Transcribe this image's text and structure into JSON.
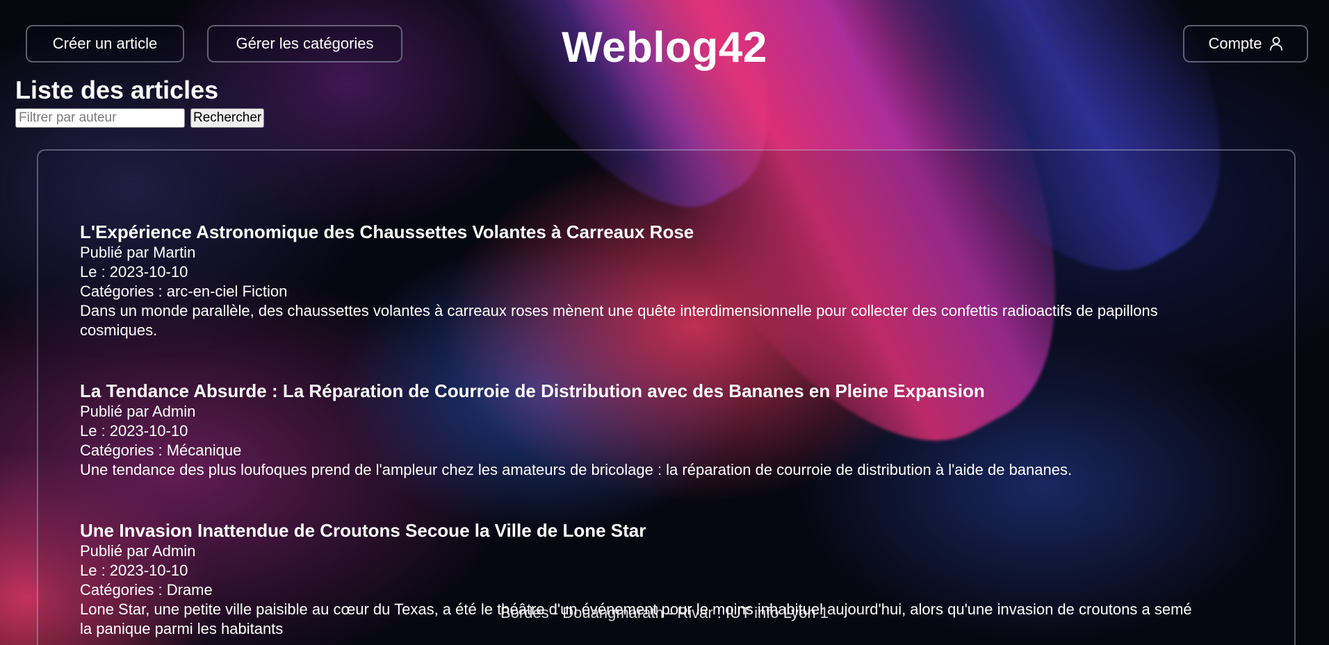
{
  "header": {
    "create_label": "Créer un article",
    "categories_label": "Gérer les catégories",
    "brand": "Weblog42",
    "account_label": "Compte",
    "account_icon": "user-icon"
  },
  "main": {
    "title": "Liste des articles",
    "filter": {
      "placeholder": "Filtrer par auteur",
      "value": "",
      "search_label": "Rechercher"
    }
  },
  "articles": [
    {
      "title": "L'Expérience Astronomique des Chaussettes Volantes à Carreaux Rose",
      "author": "Publié par Martin",
      "date": "Le : 2023-10-10",
      "categories": "Catégories : arc-en-ciel Fiction",
      "summary": "Dans un monde parallèle, des chaussettes volantes à carreaux roses mènent une quête interdimensionnelle pour collecter des confettis radioactifs de papillons cosmiques."
    },
    {
      "title": "La Tendance Absurde : La Réparation de Courroie de Distribution avec des Bananes en Pleine Expansion",
      "author": "Publié par Admin",
      "date": "Le : 2023-10-10",
      "categories": "Catégories : Mécanique",
      "summary": "Une tendance des plus loufoques prend de l'ampleur chez les amateurs de bricolage : la réparation de courroie de distribution à l'aide de bananes."
    },
    {
      "title": "Une Invasion Inattendue de Croutons Secoue la Ville de Lone Star",
      "author": "Publié par Admin",
      "date": "Le : 2023-10-10",
      "categories": "Catégories : Drame",
      "summary": "Lone Star, une petite ville paisible au cœur du Texas, a été le théâtre d'un événement pour le moins inhabituel aujourd'hui, alors qu'une invasion de croutons a semé la panique parmi les habitants"
    }
  ],
  "footer": {
    "text": "Bordes - Douangmarath - Rivar : IUT info Lyon 1"
  }
}
